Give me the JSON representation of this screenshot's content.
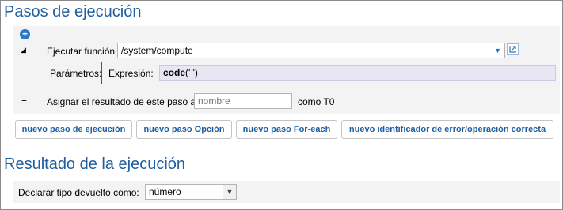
{
  "steps_section": {
    "title": "Pasos de ejecución",
    "add_icon": "plus-circle-icon",
    "expand_icon": "collapse-triangle-icon",
    "function_label": "Ejecutar función",
    "function_value": "/system/compute",
    "dropdown_icon": "chevron-down-icon",
    "open_icon": "external-link-icon",
    "params_label": "Parámetros:",
    "expression_label": "Expresión:",
    "expression_bold": "code",
    "expression_rest": "(' ')",
    "assign_marker": "=",
    "assign_label": "Asignar el resultado de este paso a",
    "assign_placeholder": "nombre",
    "assign_suffix": "como T0"
  },
  "buttons": {
    "new_step": "nuevo paso de ejecución",
    "new_option": "nuevo paso Opción",
    "new_foreach": "nuevo paso For-each",
    "new_error_handler": "nuevo identificador de error/operación correcta"
  },
  "result_section": {
    "title": "Resultado de la ejecución",
    "return_type_label": "Declarar tipo devuelto como:",
    "return_type_value": "número"
  },
  "colors": {
    "title": "#1f5fa0",
    "panel": "#f3f3f3",
    "expression_bg": "#e9e6f4",
    "accent": "#2b78c5"
  }
}
